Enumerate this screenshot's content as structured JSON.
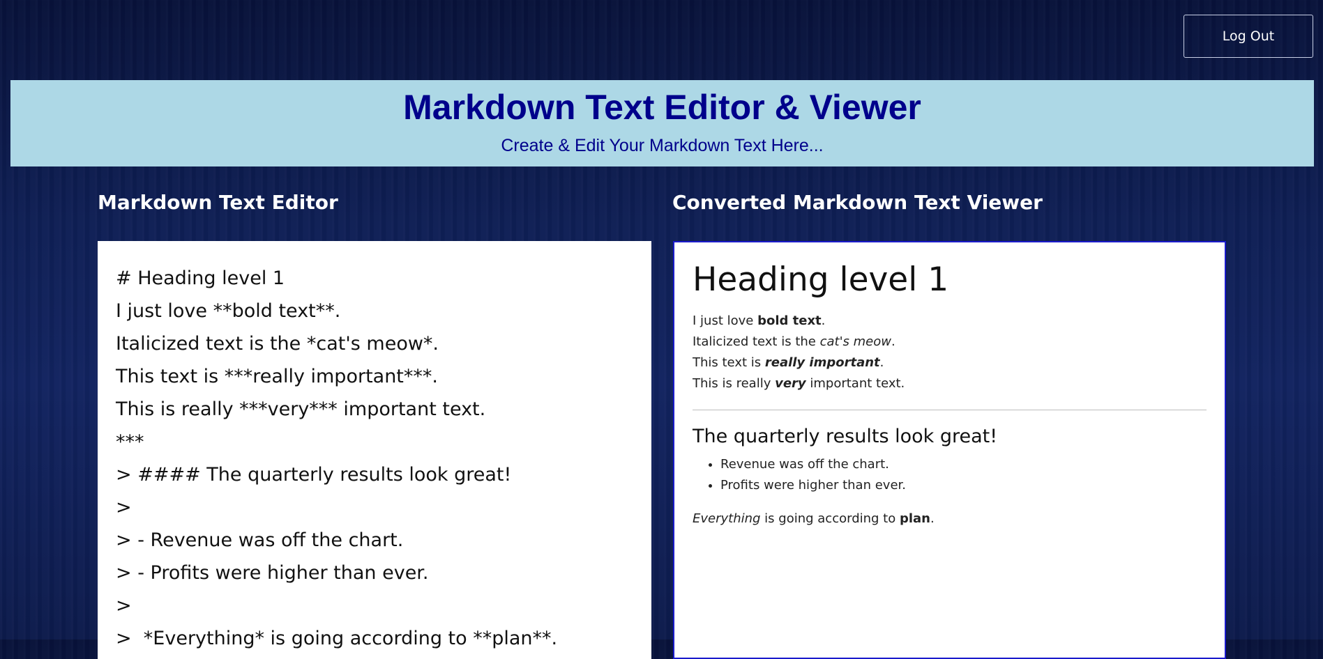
{
  "header": {
    "logout_label": "Log Out"
  },
  "banner": {
    "title": "Markdown Text Editor & Viewer",
    "subtitle": "Create & Edit Your Markdown Text Here..."
  },
  "editor": {
    "heading": "Markdown Text Editor",
    "lines": [
      "# Heading level 1",
      "I just love **bold text**.",
      "Italicized text is the *cat's meow*.",
      "This text is ***really important***.",
      "This is really ***very*** important text.",
      "***",
      "> #### The quarterly results look great!",
      ">",
      "> - Revenue was off the chart.",
      "> - Profits were higher than ever.",
      ">",
      ">  *Everything* is going according to **plan**."
    ]
  },
  "viewer": {
    "heading": "Converted Markdown Text Viewer",
    "h1": "Heading level 1",
    "line1": {
      "a": "I just love ",
      "b": "bold text",
      "c": "."
    },
    "line2": {
      "a": "Italicized text is the ",
      "b": "cat's meow",
      "c": "."
    },
    "line3": {
      "a": "This text is ",
      "b": "really important",
      "c": "."
    },
    "line4": {
      "a": "This is really ",
      "b": "very",
      "c": " important text."
    },
    "quote_heading": "The quarterly results look great!",
    "list_items": [
      "Revenue was off the chart.",
      "Profits were higher than ever."
    ],
    "final": {
      "a": "Everything",
      "b": " is going according to ",
      "c": "plan",
      "d": "."
    }
  }
}
